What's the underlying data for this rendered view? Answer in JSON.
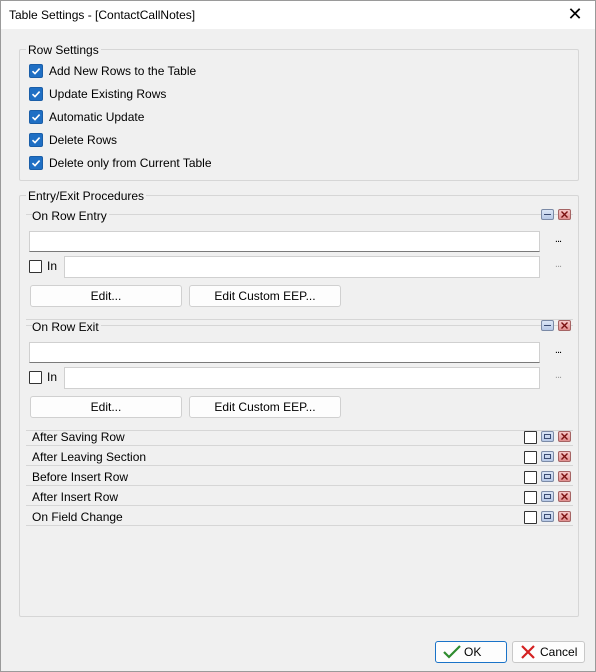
{
  "window": {
    "title": "Table Settings - [ContactCallNotes]",
    "close_glyph": "✕"
  },
  "row_settings": {
    "legend": "Row Settings",
    "options": [
      {
        "label": "Add New Rows to the Table",
        "checked": true
      },
      {
        "label": "Update Existing Rows",
        "checked": true
      },
      {
        "label": "Automatic Update",
        "checked": true
      },
      {
        "label": "Delete Rows",
        "checked": true
      },
      {
        "label": "Delete only from Current Table",
        "checked": true
      }
    ]
  },
  "entry_exit": {
    "legend": "Entry/Exit Procedures",
    "on_row_entry": {
      "title": "On Row Entry",
      "procedure_value": "",
      "in_label": "In",
      "in_checked": false,
      "in_value": "",
      "ellipsis": "...",
      "edit_label": "Edit...",
      "edit_custom_label": "Edit Custom EEP..."
    },
    "on_row_exit": {
      "title": "On Row Exit",
      "procedure_value": "",
      "in_label": "In",
      "in_checked": false,
      "in_value": "",
      "ellipsis": "...",
      "edit_label": "Edit...",
      "edit_custom_label": "Edit Custom EEP..."
    },
    "collapsed": [
      {
        "title": "After Saving Row",
        "checked": false
      },
      {
        "title": "After Leaving Section",
        "checked": false
      },
      {
        "title": "Before Insert Row",
        "checked": false
      },
      {
        "title": "After Insert Row",
        "checked": false
      },
      {
        "title": "On Field Change",
        "checked": false
      }
    ]
  },
  "footer": {
    "ok_label": "OK",
    "cancel_label": "Cancel",
    "ok_icon": "checkmark-icon",
    "cancel_icon": "red-x-icon"
  },
  "colors": {
    "accent": "#1f6fc4",
    "ok_check": "#2e8b2e",
    "cancel_x": "#d42020"
  }
}
